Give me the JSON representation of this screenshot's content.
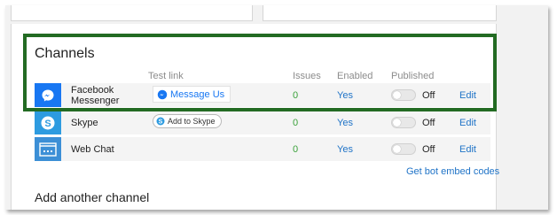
{
  "channels": {
    "heading": "Channels",
    "columns": {
      "test_link": "Test link",
      "issues": "Issues",
      "enabled": "Enabled",
      "published": "Published"
    },
    "rows": [
      {
        "name_line1": "Facebook",
        "name_line2": "Messenger",
        "icon": "messenger-icon",
        "icon_bg": "#1877f2",
        "test_button": "Message Us",
        "issues": "0",
        "enabled": "Yes",
        "published": "Off",
        "edit": "Edit"
      },
      {
        "name": "Skype",
        "icon": "skype-icon",
        "icon_bg": "#2d9be0",
        "test_button": "Add to Skype",
        "issues": "0",
        "enabled": "Yes",
        "published": "Off",
        "edit": "Edit"
      },
      {
        "name": "Web Chat",
        "icon": "webchat-icon",
        "icon_bg": "#3c8fd6",
        "issues": "0",
        "enabled": "Yes",
        "published": "Off",
        "edit": "Edit"
      }
    ],
    "embed_link": "Get bot embed codes"
  },
  "add_channel": {
    "heading": "Add another channel"
  },
  "colors": {
    "link": "#1f73c7",
    "issues_ok": "#3aa13a",
    "highlight": "#236b23"
  }
}
